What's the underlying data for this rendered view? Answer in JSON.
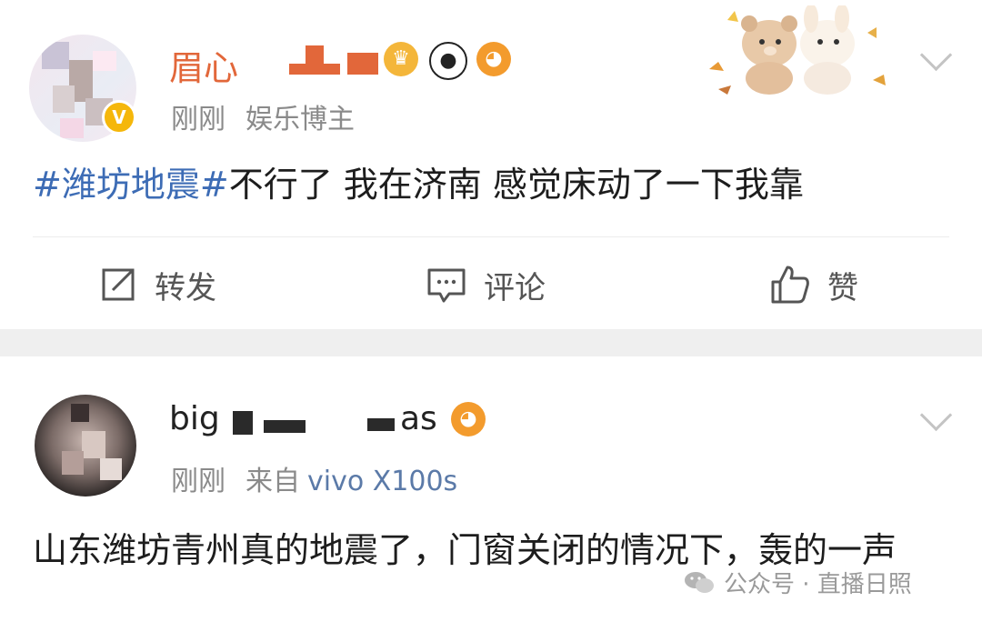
{
  "posts": [
    {
      "username": "眉心",
      "time": "刚刚",
      "tag_label": "娱乐博主",
      "hashtag": "#潍坊地震#",
      "text": "不行了 我在济南 感觉床动了一下我靠",
      "actions": {
        "repost": "转发",
        "comment": "评论",
        "like": "赞"
      }
    },
    {
      "username": "big",
      "username_tail": "as",
      "time": "刚刚",
      "source_prefix": "来自",
      "device": "vivo X100s",
      "text": "山东潍坊青州真的地震了，门窗关闭的情况下，轰的一声"
    }
  ],
  "watermark": {
    "text": "公众号 · 直播日照"
  },
  "icons": [
    "repost-icon",
    "comment-icon",
    "like-icon",
    "chevron-down-icon",
    "verified-icon",
    "wechat-icon",
    "panda-icon",
    "fish-icon",
    "crown-icon"
  ]
}
